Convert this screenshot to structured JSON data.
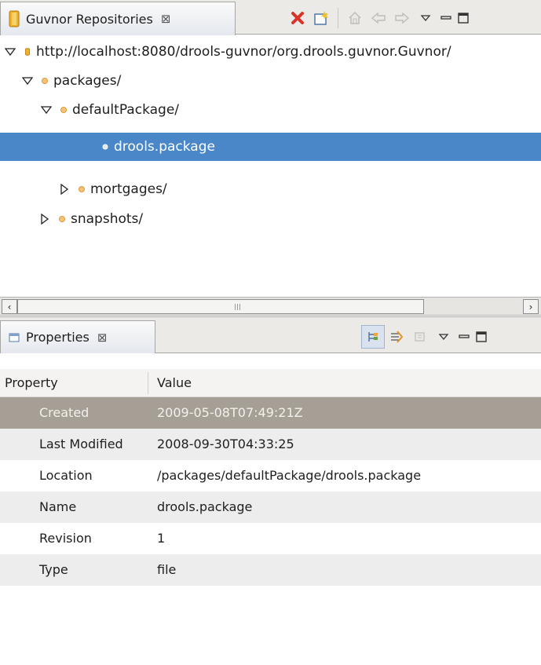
{
  "guvnor_view": {
    "tab_title": "Guvnor Repositories",
    "tab_close_glyph": "⊠",
    "toolbar_icons": [
      "delete-icon",
      "new-connection-icon",
      "home-icon",
      "back-icon",
      "forward-icon",
      "view-menu-icon",
      "minimize-icon",
      "maximize-icon"
    ],
    "tree": [
      {
        "label": "http://localhost:8080/drools-guvnor/org.drools.guvnor.Guvnor/",
        "expanded": true,
        "depth": 0
      },
      {
        "label": "packages/",
        "expanded": true,
        "depth": 1
      },
      {
        "label": "defaultPackage/",
        "expanded": true,
        "depth": 2
      },
      {
        "label": "drools.package",
        "leaf": true,
        "selected": true,
        "depth": 3
      },
      {
        "label": "mortgages/",
        "expanded": false,
        "depth": 2
      },
      {
        "label": "snapshots/",
        "expanded": false,
        "depth": 1
      }
    ],
    "scroll_grip": "III"
  },
  "properties_view": {
    "tab_title": "Properties",
    "tab_close_glyph": "⊠",
    "toolbar_icons": [
      "show-categories-icon",
      "show-advanced-icon",
      "restore-default-icon",
      "view-menu-icon",
      "minimize-icon",
      "maximize-icon"
    ],
    "columns": {
      "property": "Property",
      "value": "Value"
    },
    "rows": [
      {
        "name": "Created",
        "value": "2009-05-08T07:49:21Z",
        "selected": true
      },
      {
        "name": "Last Modified",
        "value": "2008-09-30T04:33:25"
      },
      {
        "name": "Location",
        "value": "/packages/defaultPackage/drools.package"
      },
      {
        "name": "Name",
        "value": "drools.package"
      },
      {
        "name": "Revision",
        "value": "1"
      },
      {
        "name": "Type",
        "value": "file"
      }
    ]
  },
  "colors": {
    "selection_blue": "#4a87c8",
    "selection_gray": "#a59f95",
    "tree_dot_orange": "#e8a23c",
    "delete_red": "#d9342b"
  }
}
